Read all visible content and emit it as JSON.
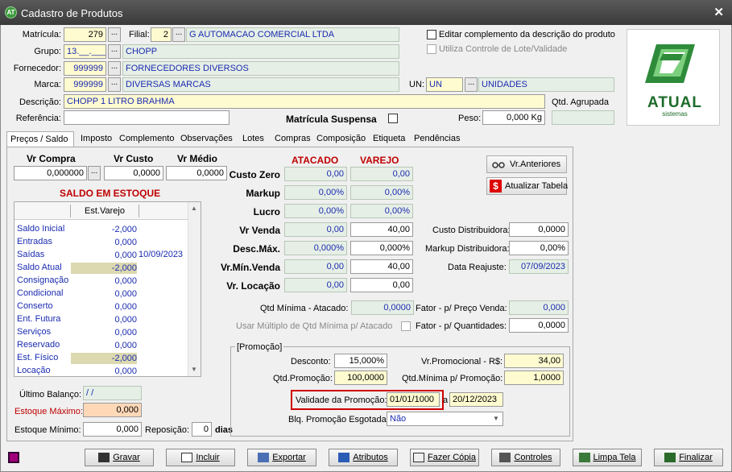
{
  "window": {
    "title": "Cadastro de Produtos",
    "close": "✕",
    "app_icon": "AT"
  },
  "header": {
    "matricula_label": "Matrícula:",
    "matricula": "279",
    "filial_label": "Filial:",
    "filial_code": "2",
    "filial_name": "G AUTOMACAO COMERCIAL LTDA",
    "editar_label": "Editar complemento da descrição do produto",
    "lote_label": "Utiliza Controle de Lote/Validade",
    "grupo_label": "Grupo:",
    "grupo_code": "13.__.___",
    "grupo_name": "CHOPP",
    "fornecedor_label": "Fornecedor:",
    "fornecedor_code": "999999",
    "fornecedor_name": "FORNECEDORES DIVERSOS",
    "marca_label": "Marca:",
    "marca_code": "999999",
    "marca_name": "DIVERSAS MARCAS",
    "un_label": "UN:",
    "un_code": "UN",
    "un_name": "UNIDADES",
    "descricao_label": "Descrição:",
    "descricao": "CHOPP 1 LITRO BRAHMA",
    "qtd_agrupada_label": "Qtd. Agrupada",
    "referencia_label": "Referência:",
    "referencia": "",
    "suspensa_label": "Matrícula Suspensa",
    "peso_label": "Peso:",
    "peso": "0,000 Kg",
    "dots": "..."
  },
  "logo": {
    "text": "ATUAL",
    "sub": "sistemas"
  },
  "tabs": [
    "Preços / Saldo",
    "Imposto",
    "Complemento",
    "Observações",
    "Lotes",
    "Compras",
    "Composição",
    "Etiqueta",
    "Pendências"
  ],
  "prices": {
    "vr_compra_label": "Vr Compra",
    "vr_custo_label": "Vr Custo",
    "vr_medio_label": "Vr Médio",
    "vr_compra": "0,000000",
    "vr_custo": "0,0000",
    "vr_medio": "0,0000"
  },
  "saldo": {
    "title": "SALDO EM ESTOQUE",
    "col": "Est.Varejo",
    "rows": [
      {
        "name": "Saldo Inicial",
        "value": "-2,000",
        "date": ""
      },
      {
        "name": "Entradas",
        "value": "0,000",
        "date": ""
      },
      {
        "name": "Saídas",
        "value": "0,000",
        "date": "10/09/2023"
      },
      {
        "name": "Saldo Atual",
        "value": "-2,000",
        "date": ""
      },
      {
        "name": "Consignação",
        "value": "0,000",
        "date": ""
      },
      {
        "name": "Condicional",
        "value": "0,000",
        "date": ""
      },
      {
        "name": "Conserto",
        "value": "0,000",
        "date": ""
      },
      {
        "name": "Ent. Futura",
        "value": "0,000",
        "date": ""
      },
      {
        "name": "Serviços",
        "value": "0,000",
        "date": ""
      },
      {
        "name": "Reservado",
        "value": "0,000",
        "date": ""
      },
      {
        "name": "Est. Físico",
        "value": "-2,000",
        "date": ""
      },
      {
        "name": "Locação",
        "value": "0,000",
        "date": ""
      }
    ],
    "ultimo_balanco_label": "Último Balanço:",
    "ultimo_balanco": " /  /",
    "estoque_max_label": "Estoque Máximo:",
    "estoque_max": "0,000",
    "estoque_min_label": "Estoque Mínimo:",
    "estoque_min": "0,000",
    "reposicao_label": "Reposição:",
    "reposicao": "0",
    "dias": "dias"
  },
  "pricing": {
    "atacado": "ATACADO",
    "varejo": "VAREJO",
    "rows": [
      {
        "label": "Custo Zero",
        "at": "0,00",
        "va": "0,00"
      },
      {
        "label": "Markup",
        "at": "0,00%",
        "va": "0,00%"
      },
      {
        "label": "Lucro",
        "at": "0,00%",
        "va": "0,00%"
      },
      {
        "label": "Vr Venda",
        "at": "0,00",
        "va": "40,00"
      },
      {
        "label": "Desc.Máx.",
        "at": "0,000%",
        "va": "0,000%"
      },
      {
        "label": "Vr.Mín.Venda",
        "at": "0,00",
        "va": "40,00"
      },
      {
        "label": "Vr. Locação",
        "at": "0,00",
        "va": "0,00"
      }
    ],
    "qtd_min_label": "Qtd Mínima - Atacado:",
    "qtd_min": "0,0000",
    "multiplo_label": "Usar Múltiplo de Qtd Mínima p/ Atacado",
    "fator_preco_label": "Fator - p/ Preço Venda:",
    "fator_preco": "0,000",
    "fator_qtd_label": "Fator - p/ Quantidades:",
    "fator_qtd": "0,0000"
  },
  "right": {
    "anteriores": "Vr.Anteriores",
    "atualizar": "Atualizar Tabela",
    "custo_dist_label": "Custo Distribuidora:",
    "custo_dist": "0,0000",
    "markup_dist_label": "Markup Distribuidora:",
    "markup_dist": "0,00%",
    "reajuste_label": "Data Reajuste:",
    "reajuste": "07/09/2023"
  },
  "promo": {
    "title": "[Promoção]",
    "desconto_label": "Desconto:",
    "desconto": "15,000%",
    "vr_promo_label": "Vr.Promocional - R$:",
    "vr_promo": "34,00",
    "qtd_promo_label": "Qtd.Promoção:",
    "qtd_promo": "100,0000",
    "qtd_min_promo_label": "Qtd.Mínima p/ Promoção:",
    "qtd_min_promo": "1,0000",
    "validade_label": "Validade da Promoção:",
    "validade_ini": "01/01/1000",
    "a": "a",
    "validade_fim": "20/12/2023",
    "bloq_label": "Blq. Promoção Esgotada:",
    "bloq": "Não"
  },
  "buttons": [
    "Gravar",
    "Incluir",
    "Exportar",
    "Atributos",
    "Fazer Cópia",
    "Controles",
    "Limpa Tela",
    "Finalizar"
  ],
  "colors": {
    "accent_red": "#d00000",
    "link_blue": "#1a2bb0",
    "field_yellow": "#fffbd0",
    "field_green": "#e6efe6"
  }
}
